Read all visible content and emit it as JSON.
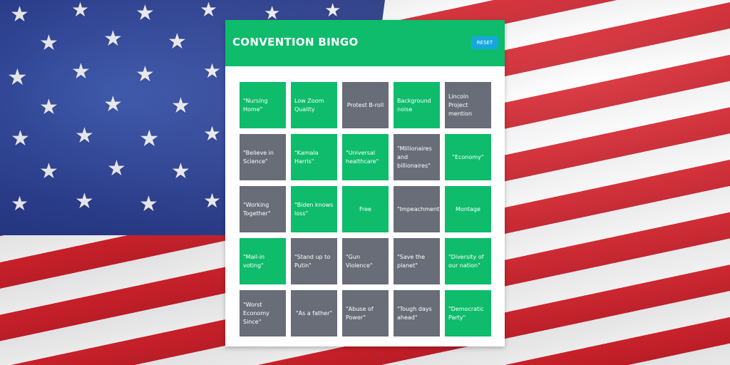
{
  "header": {
    "title": "CONVENTION BINGO",
    "reset_label": "RESET"
  },
  "colors": {
    "green": "#0ebc6b",
    "gray": "#686d78",
    "reset_blue": "#16a7df"
  },
  "cells": [
    {
      "label": "\"Nursing Home\"",
      "marked": true
    },
    {
      "label": "Low Zoom Quality",
      "marked": true
    },
    {
      "label": "Protest B-roll",
      "marked": false
    },
    {
      "label": "Background noise",
      "marked": true
    },
    {
      "label": "Lincoln Project mention",
      "marked": false
    },
    {
      "label": "\"Believe in Science\"",
      "marked": false
    },
    {
      "label": "\"Kamala Harris\"",
      "marked": true
    },
    {
      "label": "\"Universal healthcare\"",
      "marked": true
    },
    {
      "label": "\"Millionaires and billionaires\"",
      "marked": false
    },
    {
      "label": "\"Economy\"",
      "marked": true
    },
    {
      "label": "\"Working Together\"",
      "marked": false
    },
    {
      "label": "\"Biden knows loss\"",
      "marked": true
    },
    {
      "label": "Free",
      "marked": true
    },
    {
      "label": "\"Impeachment\"",
      "marked": false
    },
    {
      "label": "Montage",
      "marked": true
    },
    {
      "label": "\"Mail-in voting\"",
      "marked": true
    },
    {
      "label": "\"Stand up to Putin\"",
      "marked": false
    },
    {
      "label": "\"Gun Violence\"",
      "marked": false
    },
    {
      "label": "\"Save the planet\"",
      "marked": false
    },
    {
      "label": "\"Diversity of our nation\"",
      "marked": true
    },
    {
      "label": "\"Worst Economy Since\"",
      "marked": false
    },
    {
      "label": "\"As a father\"",
      "marked": false
    },
    {
      "label": "\"Abuse of Power\"",
      "marked": false
    },
    {
      "label": "\"Tough days ahead\"",
      "marked": false
    },
    {
      "label": "\"Democratic Party\"",
      "marked": true
    }
  ]
}
